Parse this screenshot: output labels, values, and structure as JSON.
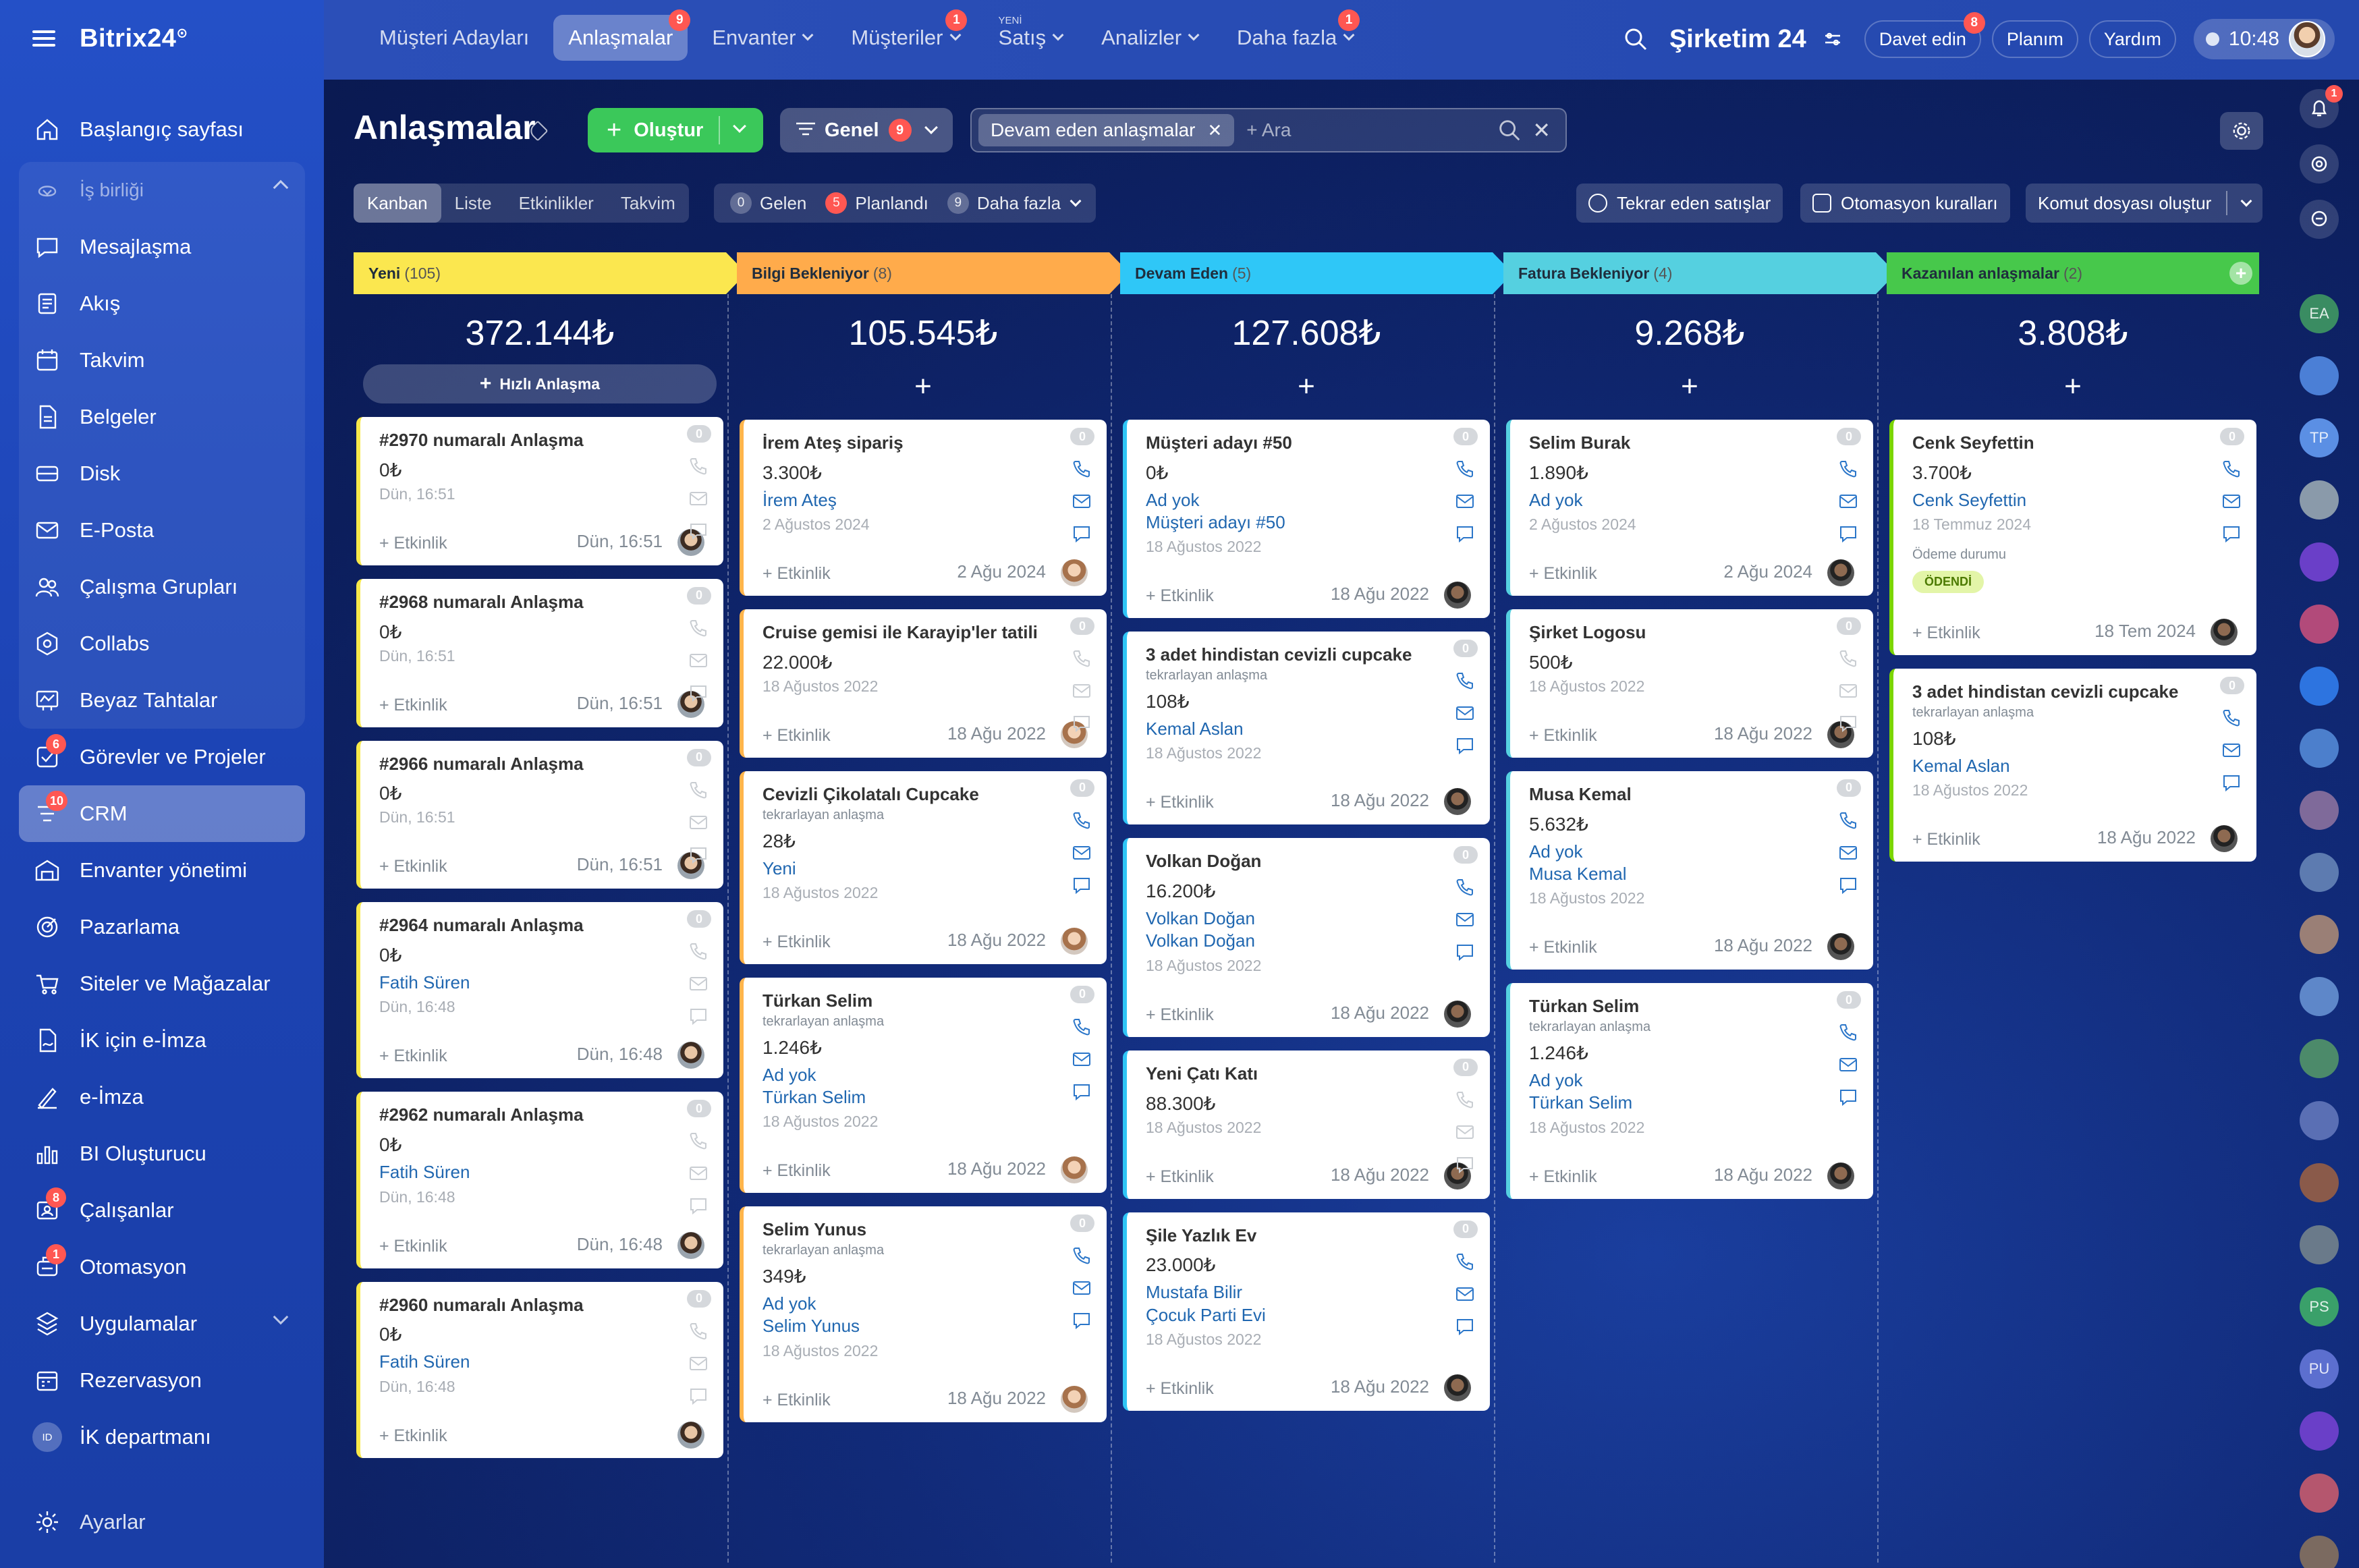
{
  "app": {
    "logo": "Bitrix24",
    "logo_mark": "⊙"
  },
  "sidebar": {
    "items": [
      {
        "label": "Başlangıç sayfası",
        "icon": "home-icon"
      },
      {
        "label": "İş birliği",
        "icon": "collab-icon",
        "group_header": true
      },
      {
        "label": "Mesajlaşma",
        "icon": "chat-icon"
      },
      {
        "label": "Akış",
        "icon": "feed-icon"
      },
      {
        "label": "Takvim",
        "icon": "calendar-icon"
      },
      {
        "label": "Belgeler",
        "icon": "document-icon"
      },
      {
        "label": "Disk",
        "icon": "disk-icon"
      },
      {
        "label": "E-Posta",
        "icon": "mail-icon"
      },
      {
        "label": "Çalışma Grupları",
        "icon": "groups-icon"
      },
      {
        "label": "Collabs",
        "icon": "collabs-icon"
      },
      {
        "label": "Beyaz Tahtalar",
        "icon": "whiteboard-icon"
      },
      {
        "label": "Görevler ve Projeler",
        "icon": "tasks-icon",
        "badge": "6"
      },
      {
        "label": "CRM",
        "icon": "crm-icon",
        "badge": "10",
        "active": true
      },
      {
        "label": "Envanter yönetimi",
        "icon": "inventory-icon"
      },
      {
        "label": "Pazarlama",
        "icon": "marketing-icon"
      },
      {
        "label": "Siteler ve Mağazalar",
        "icon": "cart-icon"
      },
      {
        "label": "İK için e-İmza",
        "icon": "hr-sign-icon"
      },
      {
        "label": "e-İmza",
        "icon": "sign-icon"
      },
      {
        "label": "BI Oluşturucu",
        "icon": "bi-icon"
      },
      {
        "label": "Çalışanlar",
        "icon": "employees-icon",
        "badge": "8"
      },
      {
        "label": "Otomasyon",
        "icon": "automation-icon",
        "badge": "1"
      },
      {
        "label": "Uygulamalar",
        "icon": "apps-icon"
      },
      {
        "label": "Rezervasyon",
        "icon": "booking-icon"
      },
      {
        "label": "İK departmanı",
        "icon": "hr-avatar",
        "avatar_text": "ID"
      }
    ],
    "settings": "Ayarlar"
  },
  "topbar": {
    "tabs": [
      {
        "label": "Müşteri Adayları"
      },
      {
        "label": "Anlaşmalar",
        "badge": "9",
        "active": true
      },
      {
        "label": "Envanter",
        "caret": true
      },
      {
        "label": "Müşteriler",
        "badge": "1",
        "caret": true
      },
      {
        "label": "Satış",
        "new": "YENİ",
        "caret": true
      },
      {
        "label": "Analizler",
        "caret": true
      },
      {
        "label": "Daha fazla",
        "badge": "1",
        "caret": true
      }
    ],
    "company": "Şirketim 24",
    "invite": "Davet edin",
    "invite_badge": "8",
    "plan": "Planım",
    "help": "Yardım",
    "time": "10:48"
  },
  "header": {
    "title": "Anlaşmalar",
    "create": "Oluştur",
    "general": "Genel",
    "general_badge": "9",
    "filter_chip": "Devam eden anlaşmalar",
    "search_placeholder": "+ Ara"
  },
  "views": [
    "Kanban",
    "Liste",
    "Etkinlikler",
    "Takvim"
  ],
  "counters": [
    {
      "count": "0",
      "label": "Gelen"
    },
    {
      "count": "5",
      "label": "Planlandı",
      "red": true
    },
    {
      "count": "9",
      "label": "Daha fazla",
      "caret": true
    }
  ],
  "actions": {
    "recurring": "Tekrar eden satışlar",
    "automation": "Otomasyon kuralları",
    "script": "Komut dosyası oluştur"
  },
  "kanban": {
    "activity": "+ Etkinlik",
    "quick_deal": "Hızlı Anlaşma",
    "paid_label": "Ödeme durumu",
    "paid_badge": "ÖDENDİ",
    "columns": [
      {
        "name": "Yeni",
        "count": "(105)",
        "sum": "372.144₺",
        "color": "#fbe74f",
        "cards": [
          {
            "title": "#2970 numaralı Anlaşma",
            "amount": "0₺",
            "date": "Dün, 16:51",
            "when": "Dün, 16:51"
          },
          {
            "title": "#2968 numaralı Anlaşma",
            "amount": "0₺",
            "date": "Dün, 16:51",
            "when": "Dün, 16:51"
          },
          {
            "title": "#2966 numaralı Anlaşma",
            "amount": "0₺",
            "date": "Dün, 16:51",
            "when": "Dün, 16:51"
          },
          {
            "title": "#2964 numaralı Anlaşma",
            "amount": "0₺",
            "link": "Fatih Süren",
            "date": "Dün, 16:48",
            "when": "Dün, 16:48"
          },
          {
            "title": "#2962 numaralı Anlaşma",
            "amount": "0₺",
            "link": "Fatih Süren",
            "date": "Dün, 16:48",
            "when": "Dün, 16:48"
          },
          {
            "title": "#2960 numaralı Anlaşma",
            "amount": "0₺",
            "link": "Fatih Süren",
            "date": "Dün, 16:48",
            "when": ""
          }
        ]
      },
      {
        "name": "Bilgi Bekleniyor",
        "count": "(8)",
        "sum": "105.545₺",
        "color": "#ffab4b",
        "cards": [
          {
            "title": "İrem Ateş sipariş",
            "amount": "3.300₺",
            "link": "İrem Ateş",
            "date": "2 Ağustos 2024",
            "when": "2 Ağu 2024"
          },
          {
            "title": "Cruise gemisi ile Karayip'ler tatili",
            "amount": "22.000₺",
            "date": "18 Ağustos 2022",
            "when": "18 Ağu 2022"
          },
          {
            "title": "Cevizli Çikolatalı Cupcake",
            "sub": "tekrarlayan anlaşma",
            "amount": "28₺",
            "link": "Yeni",
            "date": "18 Ağustos 2022",
            "when": "18 Ağu 2022"
          },
          {
            "title": "Türkan Selim",
            "sub": "tekrarlayan anlaşma",
            "amount": "1.246₺",
            "link": "Ad yok",
            "link2": "Türkan Selim",
            "date": "18 Ağustos 2022",
            "when": "18 Ağu 2022"
          },
          {
            "title": "Selim Yunus",
            "sub": "tekrarlayan anlaşma",
            "amount": "349₺",
            "link": "Ad yok",
            "link2": "Selim Yunus",
            "date": "18 Ağustos 2022",
            "when": "18 Ağu 2022"
          }
        ]
      },
      {
        "name": "Devam Eden",
        "count": "(5)",
        "sum": "127.608₺",
        "color": "#2fc7f7",
        "cards": [
          {
            "title": "Müşteri adayı #50",
            "amount": "0₺",
            "link": "Ad yok",
            "link2": "Müşteri adayı #50",
            "date": "18 Ağustos 2022",
            "when": "18 Ağu 2022"
          },
          {
            "title": "3 adet hindistan cevizli cupcake",
            "sub": "tekrarlayan anlaşma",
            "amount": "108₺",
            "link": "Kemal Aslan",
            "date": "18 Ağustos 2022",
            "when": "18 Ağu 2022"
          },
          {
            "title": "Volkan Doğan",
            "amount": "16.200₺",
            "link": "Volkan Doğan",
            "link2": "Volkan Doğan",
            "date": "18 Ağustos 2022",
            "when": "18 Ağu 2022"
          },
          {
            "title": "Yeni Çatı Katı",
            "amount": "88.300₺",
            "date": "18 Ağustos 2022",
            "when": "18 Ağu 2022"
          },
          {
            "title": "Şile Yazlık Ev",
            "amount": "23.000₺",
            "link": "Mustafa Bilir",
            "link2": "Çocuk Parti Evi",
            "date": "18 Ağustos 2022",
            "when": "18 Ağu 2022"
          }
        ]
      },
      {
        "name": "Fatura Bekleniyor",
        "count": "(4)",
        "sum": "9.268₺",
        "color": "#55d0e0",
        "cards": [
          {
            "title": "Selim Burak",
            "amount": "1.890₺",
            "link": "Ad yok",
            "date": "2 Ağustos 2024",
            "when": "2 Ağu 2024"
          },
          {
            "title": "Şirket Logosu",
            "amount": "500₺",
            "date": "18 Ağustos 2022",
            "when": "18 Ağu 2022"
          },
          {
            "title": "Musa Kemal",
            "amount": "5.632₺",
            "link": "Ad yok",
            "link2": "Musa Kemal",
            "date": "18 Ağustos 2022",
            "when": "18 Ağu 2022"
          },
          {
            "title": "Türkan Selim",
            "sub": "tekrarlayan anlaşma",
            "amount": "1.246₺",
            "link": "Ad yok",
            "link2": "Türkan Selim",
            "date": "18 Ağustos 2022",
            "when": "18 Ağu 2022"
          }
        ]
      },
      {
        "name": "Kazanılan anlaşmalar",
        "count": "(2)",
        "sum": "3.808₺",
        "color": "#47c84b",
        "cards": [
          {
            "title": "Cenk Seyfettin",
            "amount": "3.700₺",
            "link": "Cenk Seyfettin",
            "date": "18 Temmuz 2024",
            "when": "18 Tem 2024",
            "paid": true
          },
          {
            "title": "3 adet hindistan cevizli cupcake",
            "sub": "tekrarlayan anlaşma",
            "amount": "108₺",
            "link": "Kemal Aslan",
            "date": "18 Ağustos 2022",
            "when": "18 Ağu 2022"
          }
        ]
      }
    ]
  },
  "rail": {
    "notification_badge": "1",
    "avatars": [
      "EA",
      "TP",
      "PS",
      "PU"
    ]
  }
}
